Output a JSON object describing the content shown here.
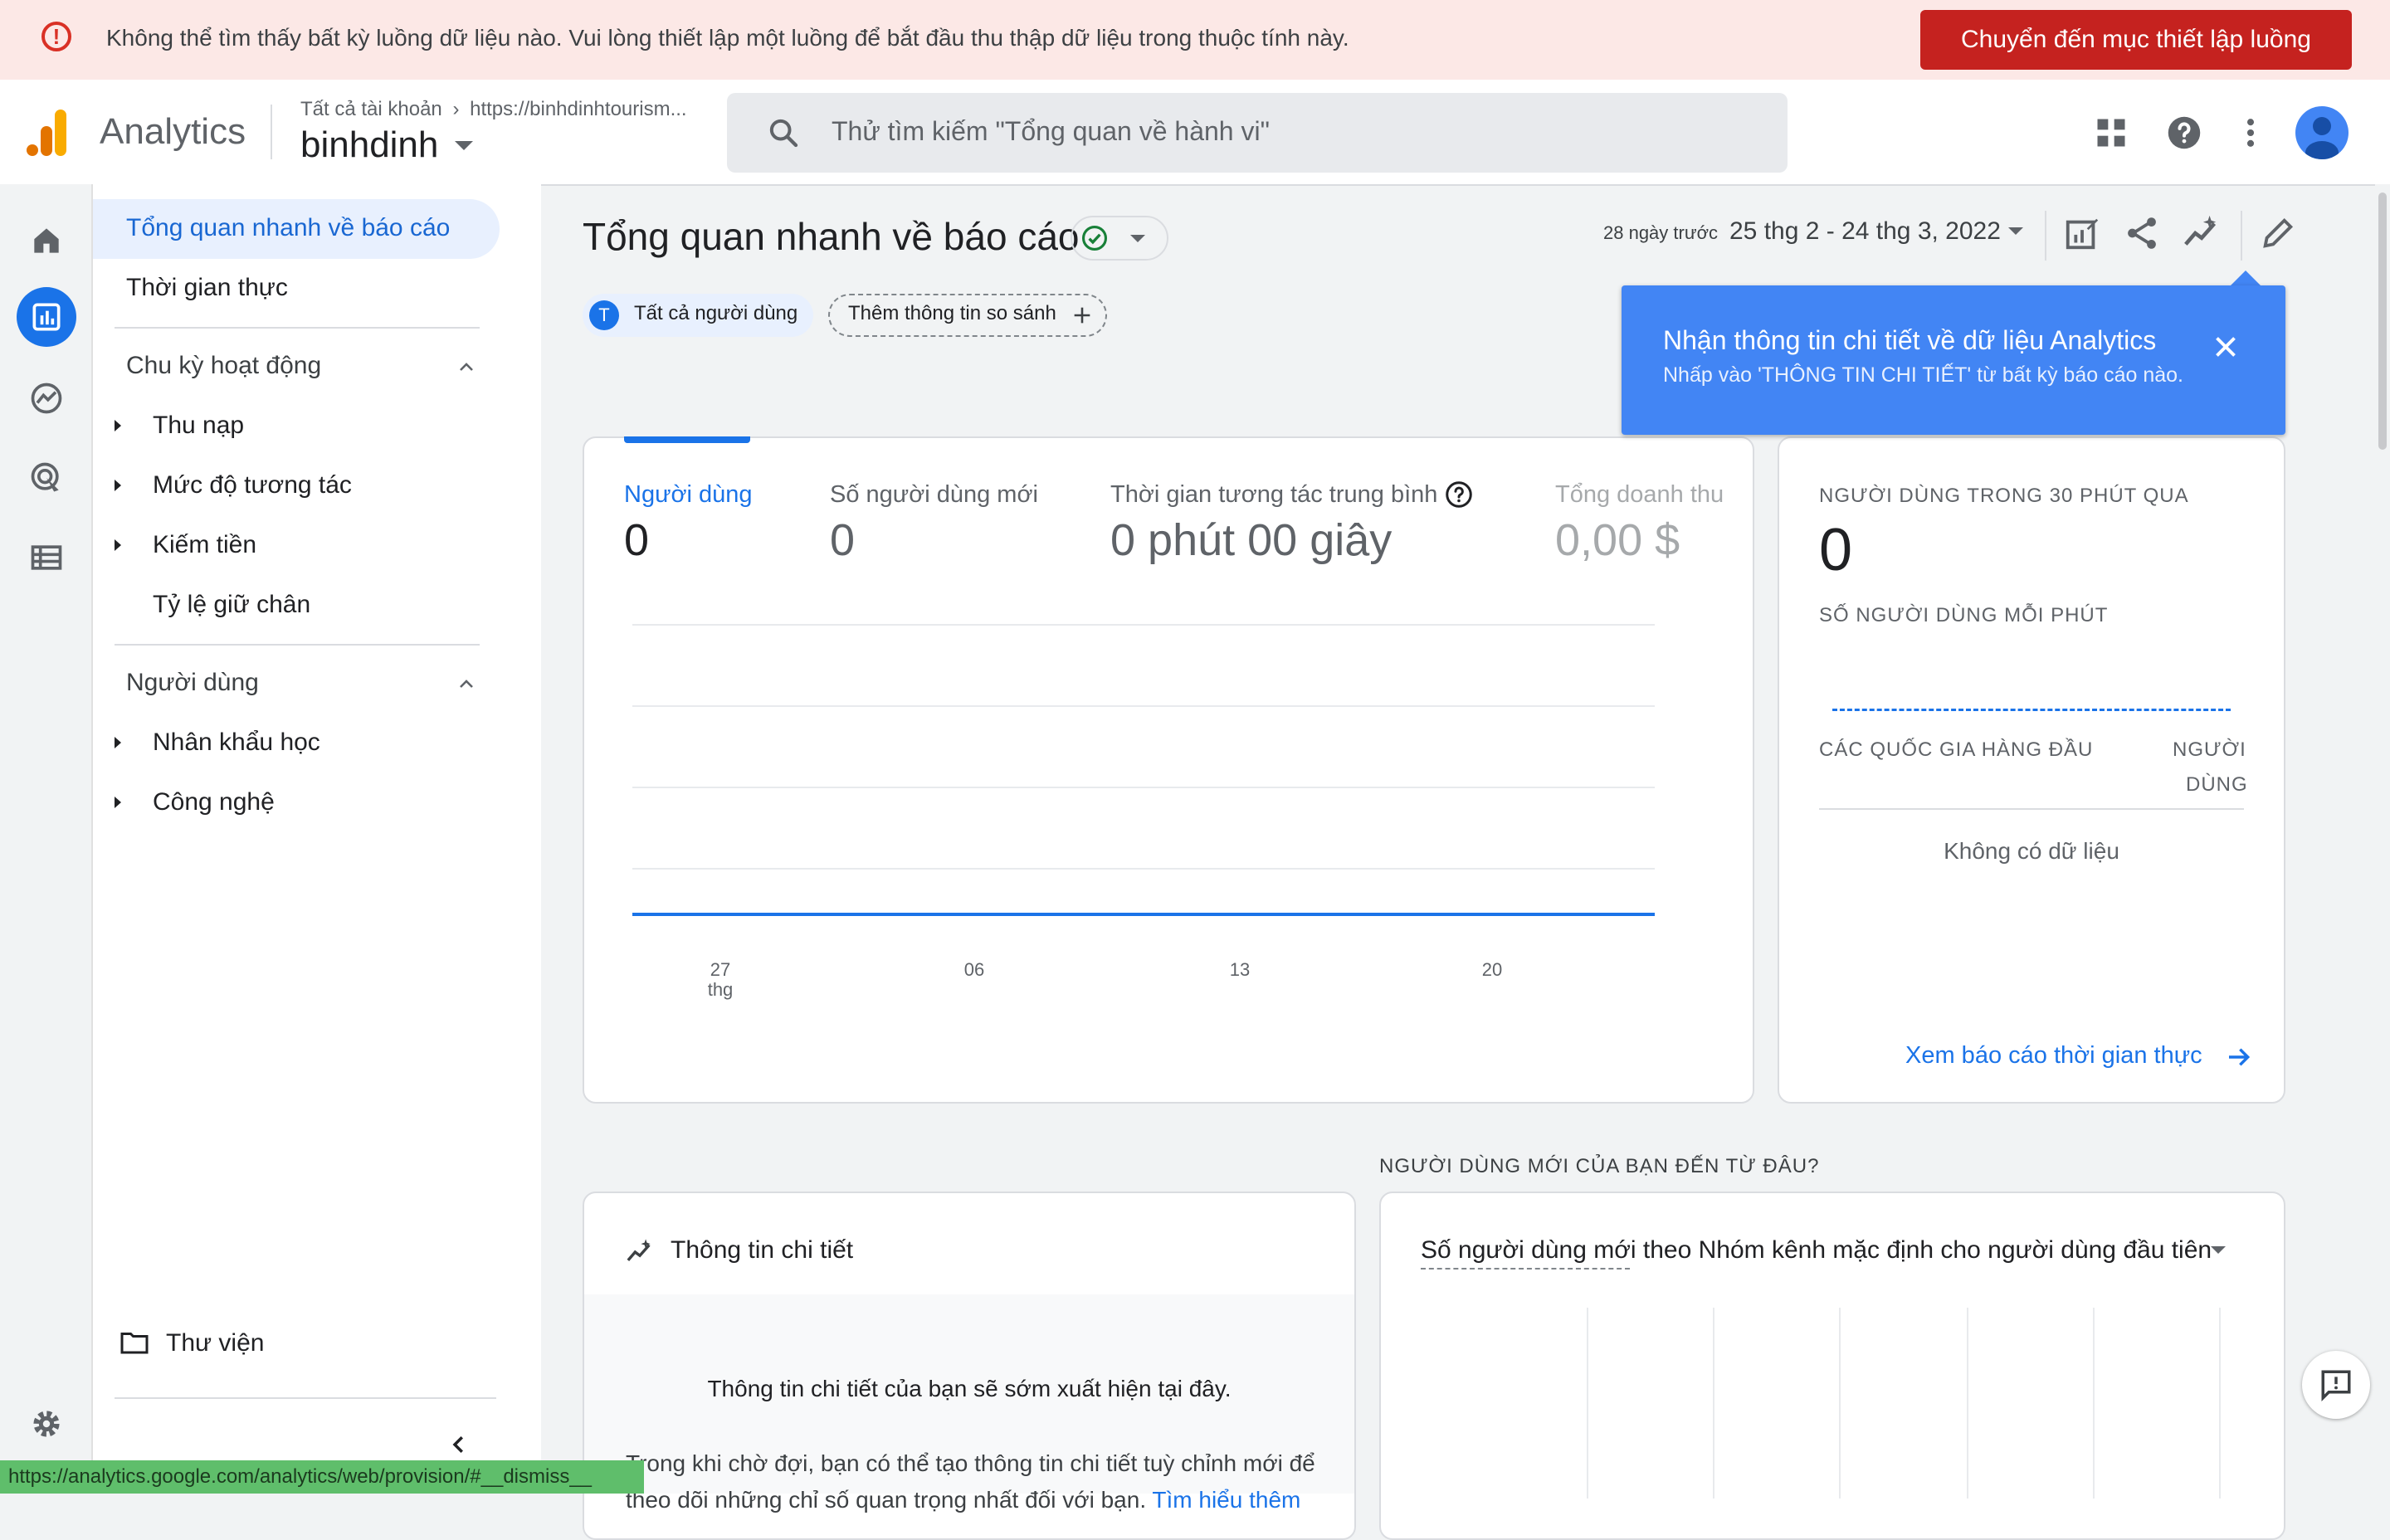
{
  "banner": {
    "message": "Không thể tìm thấy bất kỳ luồng dữ liệu nào. Vui lòng thiết lập một luồng để bắt đầu thu thập dữ liệu trong thuộc tính này.",
    "button": "Chuyển đến mục thiết lập luồng",
    "color": "#c5221f"
  },
  "header": {
    "app_name": "Analytics",
    "breadcrumb_root": "Tất cả tài khoản",
    "breadcrumb_url": "https://binhdinhtourism...",
    "property": "binhdinh",
    "search_placeholder": "Thử tìm kiếm \"Tổng quan về hành vi\"",
    "icons": [
      "apps-icon",
      "help-icon",
      "more-vert-icon",
      "avatar"
    ]
  },
  "rail": {
    "icons": [
      "home-icon",
      "reports-icon",
      "explore-icon",
      "advertising-icon",
      "configure-icon",
      "settings-icon"
    ],
    "active": "reports-icon",
    "accent": "#1a73e8"
  },
  "nav": {
    "overview": "Tổng quan nhanh về báo cáo",
    "realtime": "Thời gian thực",
    "section_lifecycle": "Chu kỳ hoạt động",
    "acquisition": "Thu nạp",
    "engagement": "Mức độ tương tác",
    "monetization": "Kiếm tiền",
    "retention": "Tỷ lệ giữ chân",
    "section_user": "Người dùng",
    "demographics": "Nhân khẩu học",
    "tech": "Công nghệ",
    "library": "Thư viện"
  },
  "main": {
    "title": "Tổng quan nhanh về báo cáo",
    "date_prefix": "28 ngày trước",
    "date_range": "25 thg 2 - 24 thg 3, 2022",
    "segment_initial": "T",
    "segment": "Tất cả người dùng",
    "compare": "Thêm thông tin so sánh",
    "toolbar_icons": [
      "customize-report-icon",
      "share-icon",
      "insights-icon",
      "edit-icon"
    ]
  },
  "tooltip": {
    "title": "Nhận thông tin chi tiết về dữ liệu Analytics",
    "body": "Nhấp vào 'THÔNG TIN CHI TIẾT' từ bất kỳ báo cáo nào."
  },
  "metrics": [
    {
      "label": "Người dùng",
      "value": "0",
      "active": true
    },
    {
      "label": "Số người dùng mới",
      "value": "0"
    },
    {
      "label": "Thời gian tương tác trung bình",
      "value": "0 phút 00 giây"
    },
    {
      "label": "Tổng doanh thu",
      "value": "0,00 $"
    }
  ],
  "chart_data": {
    "type": "line",
    "x_ticks": [
      {
        "label": "27",
        "sublabel": "thg"
      },
      {
        "label": "06"
      },
      {
        "label": "13"
      },
      {
        "label": "20"
      }
    ],
    "series": [
      {
        "values": [
          0,
          0,
          0,
          0,
          0,
          0,
          0,
          0,
          0,
          0,
          0,
          0,
          0,
          0,
          0,
          0,
          0,
          0,
          0,
          0,
          0,
          0,
          0,
          0,
          0,
          0,
          0,
          0
        ]
      }
    ],
    "grid": true,
    "color": "#1a73e8"
  },
  "realtime": {
    "caption": "NGƯỜI DÙNG TRONG 30 PHÚT QUA",
    "value": "0",
    "per_minute": "SỐ NGƯỜI DÙNG MỖI PHÚT",
    "col_countries": "CÁC QUỐC GIA HÀNG ĐẦU",
    "col_users_1": "NGƯỜI",
    "col_users_2": "DÙNG",
    "no_data": "Không có dữ liệu",
    "link": "Xem báo cáo thời gian thực"
  },
  "section_caption": "NGƯỜI DÙNG MỚI CỦA BẠN ĐẾN TỪ ĐÂU?",
  "insights": {
    "title": "Thông tin chi tiết",
    "main": "Thông tin chi tiết của bạn sẽ sớm xuất hiện tại đây.",
    "sub_line1": "Trong khi chờ đợi, bạn có thể tạo thông tin chi tiết tuỳ chỉnh mới để",
    "sub_line2": "theo dõi những chỉ số quan trọng nhất đối với bạn.",
    "learn_more": "Tìm hiểu thêm"
  },
  "source": {
    "title": "Số người dùng mới theo Nhóm kênh mặc định cho người dùng đầu tiên"
  },
  "status_url": "https://analytics.google.com/analytics/web/provision/#__dismiss__"
}
